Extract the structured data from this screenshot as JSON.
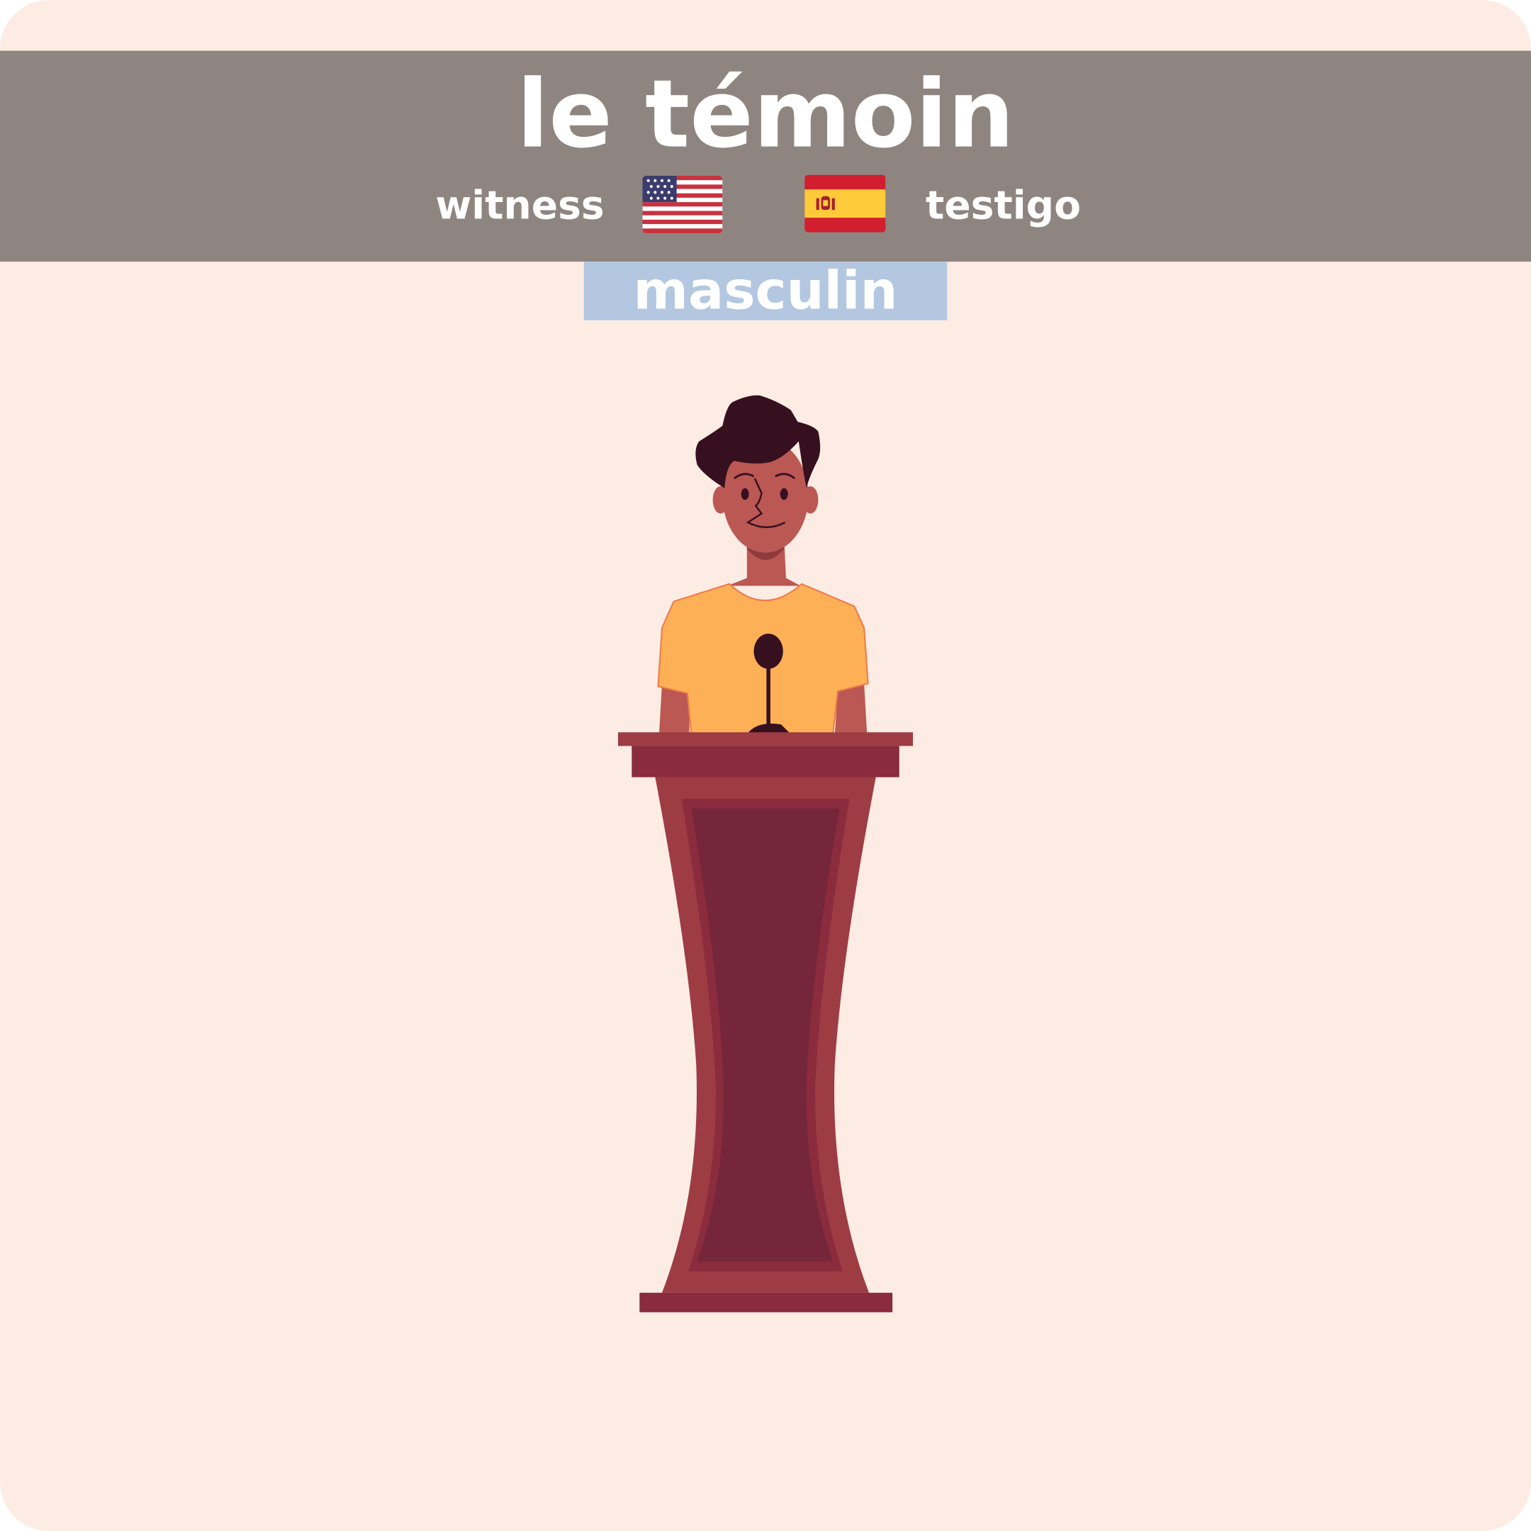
{
  "card": {
    "title": "le témoin",
    "english": "witness",
    "spanish": "testigo",
    "gender": "masculin",
    "flags": {
      "english": "us-flag-icon",
      "spanish": "spain-flag-icon"
    },
    "illustration": "witness-at-podium",
    "colors": {
      "background": "#fdece4",
      "band": "#8f8580",
      "gender_badge": "#b3c7e0"
    }
  }
}
